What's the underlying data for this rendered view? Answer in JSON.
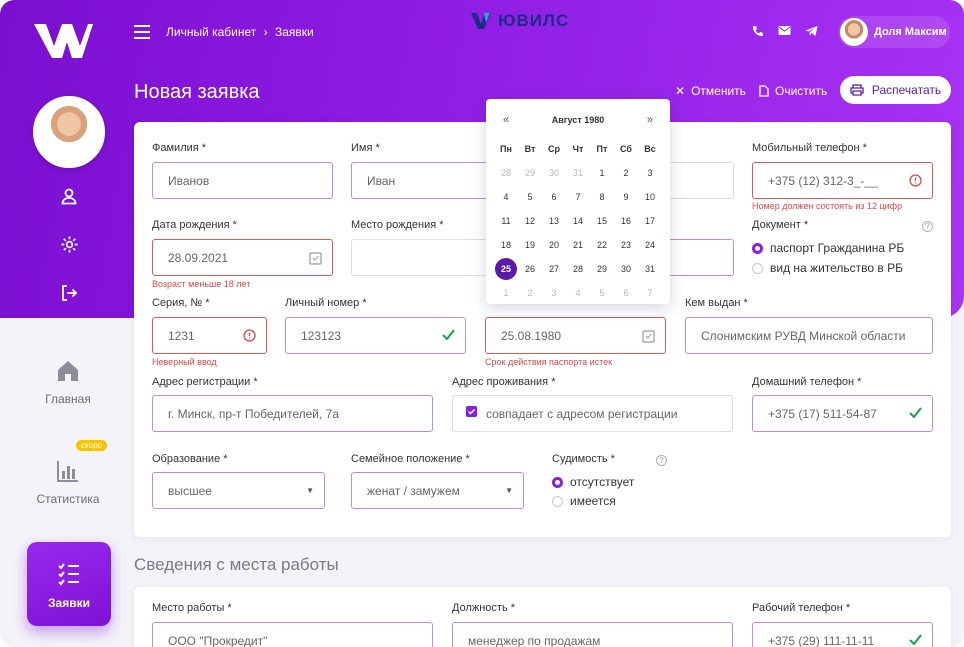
{
  "colors": {
    "brand": "#8a1fe0",
    "error": "#e04848",
    "success": "#1aa34a"
  },
  "sidebar": {
    "nav": [
      {
        "label": "Главная",
        "icon": "home-icon"
      },
      {
        "label": "Статистика",
        "icon": "chart-icon",
        "badge": "скоро"
      },
      {
        "label": "Заявки",
        "icon": "checklist-icon",
        "active": true
      }
    ]
  },
  "topbar": {
    "breadcrumb": [
      "Личный кабинет",
      "Заявки"
    ],
    "brand": "ЮВИЛС",
    "user_name": "Доля Максим"
  },
  "page": {
    "title": "Новая заявка",
    "cancel_label": "Отменить",
    "clear_label": "Очистить",
    "print_label": "Распечатать"
  },
  "form": {
    "surname": {
      "label": "Фамилия *",
      "value": "Иванов"
    },
    "name": {
      "label": "Имя *",
      "value": "Иван"
    },
    "mobile": {
      "label": "Мобильный телефон *",
      "value": "+375 (12) 312-3_-__",
      "error": "Номер должен состоять из 12 цифр"
    },
    "birth_date": {
      "label": "Дата рождения *",
      "value": "28.09.2021",
      "error": "Возраст меньше 18 лет"
    },
    "birth_place": {
      "label": "Место рождения *",
      "value": ""
    },
    "document": {
      "label": "Документ *",
      "options": [
        "паспорт Гражданина РБ",
        "вид на жительство в РБ"
      ],
      "selected": 0
    },
    "series": {
      "label": "Серия, № *",
      "value": "1231",
      "error": "Неверный ввод"
    },
    "personal_no": {
      "label": "Личный номер *",
      "value": "123123"
    },
    "expiry": {
      "value": "25.08.1980",
      "error": "Срок действия паспорта истек"
    },
    "issued_by": {
      "label": "Кем выдан *",
      "value": "Слонимским РУВД Минской области"
    },
    "reg_address": {
      "label": "Адрес регистрации *",
      "value": "г. Минск, пр-т Победителей, 7а"
    },
    "live_address": {
      "label": "Адрес проживания *",
      "checkbox": "совпадает с адресом регистрации"
    },
    "home_phone": {
      "label": "Домашний телефон *",
      "value": "+375 (17) 511-54-87"
    },
    "education": {
      "label": "Образование *",
      "value": "высшее"
    },
    "marital": {
      "label": "Семейное положение *",
      "value": "женат / замужем"
    },
    "conviction": {
      "label": "Судимость *",
      "options": [
        "отсутствует",
        "имеется"
      ],
      "selected": 0
    }
  },
  "calendar": {
    "month_label": "Август 1980",
    "prev": "«",
    "next": "»",
    "weekdays": [
      "Пн",
      "Вт",
      "Ср",
      "Чт",
      "Пт",
      "Сб",
      "Вс"
    ],
    "days": [
      [
        "28",
        "29",
        "30",
        "31",
        "1",
        "2",
        "3"
      ],
      [
        "4",
        "5",
        "6",
        "7",
        "8",
        "9",
        "10"
      ],
      [
        "11",
        "12",
        "13",
        "14",
        "15",
        "16",
        "17"
      ],
      [
        "18",
        "19",
        "20",
        "21",
        "22",
        "23",
        "24"
      ],
      [
        "25",
        "26",
        "27",
        "28",
        "29",
        "30",
        "31"
      ],
      [
        "1",
        "2",
        "3",
        "4",
        "5",
        "6",
        "7"
      ]
    ],
    "selected": "25"
  },
  "work": {
    "title": "Сведения с места работы",
    "place": {
      "label": "Место работы *",
      "value": "ООО \"Прокредит\""
    },
    "position": {
      "label": "Должность *",
      "value": "менеджер по продажам"
    },
    "phone": {
      "label": "Рабочий телефон *",
      "value": "+375 (29) 111-11-11"
    }
  }
}
